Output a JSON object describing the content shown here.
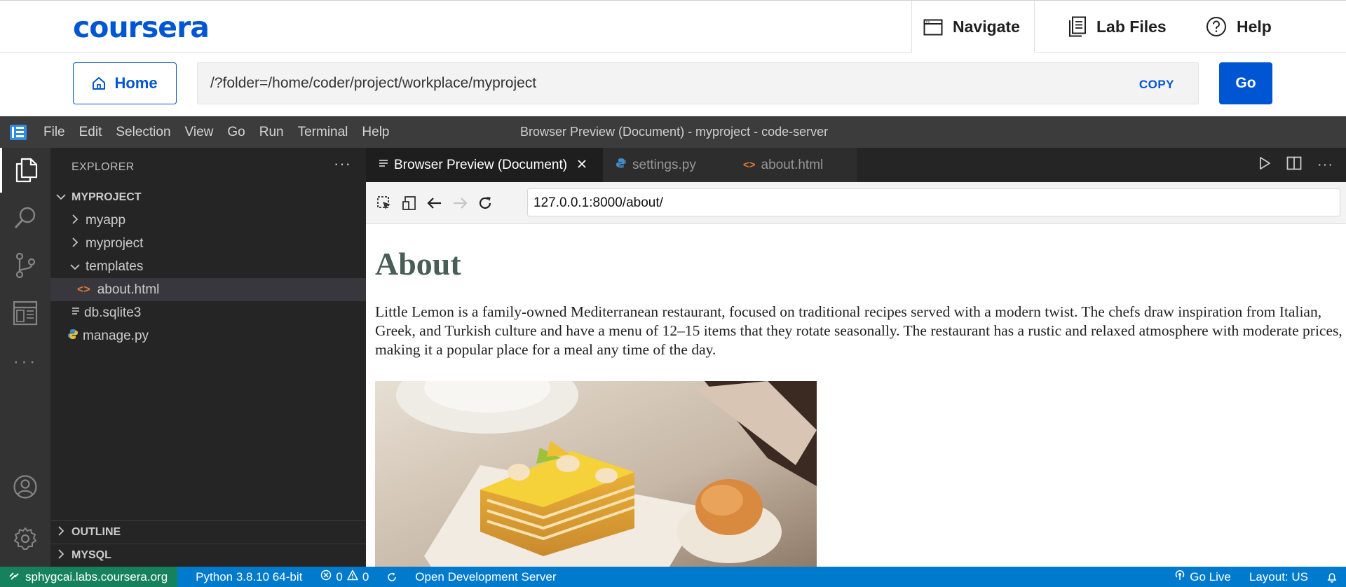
{
  "coursera": {
    "logo": "coursera",
    "nav": {
      "navigate": "Navigate",
      "lab_files": "Lab Files",
      "help": "Help"
    },
    "home_label": "Home",
    "path": "/?folder=/home/coder/project/workplace/myproject",
    "copy_label": "COPY",
    "go_label": "Go"
  },
  "vscode": {
    "menu": [
      "File",
      "Edit",
      "Selection",
      "View",
      "Go",
      "Run",
      "Terminal",
      "Help"
    ],
    "window_title": "Browser Preview (Document) - myproject - code-server",
    "explorer": {
      "title": "EXPLORER",
      "more": "···",
      "project": "MYPROJECT",
      "items": [
        {
          "label": "myapp"
        },
        {
          "label": "myproject"
        },
        {
          "label": "templates"
        },
        {
          "label": "about.html"
        },
        {
          "label": "db.sqlite3"
        },
        {
          "label": "manage.py"
        }
      ],
      "outline": "OUTLINE",
      "mysql": "MYSQL"
    },
    "tabs": [
      {
        "label": "Browser Preview (Document)"
      },
      {
        "label": "settings.py"
      },
      {
        "label": "about.html"
      }
    ],
    "browser": {
      "url": "127.0.0.1:8000/about/",
      "heading": "About",
      "paragraph": "Little Lemon is a family-owned Mediterranean restaurant, focused on traditional recipes served with a modern twist. The chefs draw inspiration from Italian, Greek, and Turkish culture and have a menu of 12–15 items that they rotate seasonally. The restaurant has a rustic and relaxed atmosphere with moderate prices, making it a popular place for a meal any time of the day."
    },
    "status": {
      "remote": "sphygcai.labs.coursera.org",
      "python": "Python 3.8.10 64-bit",
      "errors": "0",
      "warnings": "0",
      "server": "Open Development Server",
      "go_live": "Go Live",
      "layout": "Layout: US"
    },
    "colors": {
      "accent": "#0056d2",
      "status_bar": "#007acc",
      "remote": "#16825d",
      "heading": "#495e57"
    }
  }
}
